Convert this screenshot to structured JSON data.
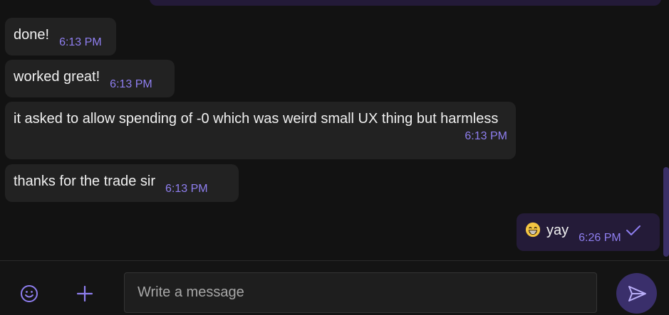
{
  "messages": [
    {
      "text": "done!",
      "time": "6:13 PM"
    },
    {
      "text": "worked great!",
      "time": "6:13 PM"
    },
    {
      "text": "it asked to allow spending of -0 which was weird small UX thing but harmless",
      "time": "6:13 PM"
    },
    {
      "text": "thanks for the trade sir",
      "time": "6:13 PM"
    }
  ],
  "outgoing": {
    "emoji": "grinning-face-emoji",
    "text": "yay",
    "time": "6:26 PM",
    "status_icon": "check-icon"
  },
  "composer": {
    "placeholder": "Write a message",
    "emoji_icon": "emoji-icon",
    "attach_icon": "plus-icon",
    "send_icon": "send-icon"
  },
  "colors": {
    "background": "#121212",
    "incoming_bubble": "#222222",
    "outgoing_bubble": "#241b38",
    "accent": "#8f7ff0"
  }
}
